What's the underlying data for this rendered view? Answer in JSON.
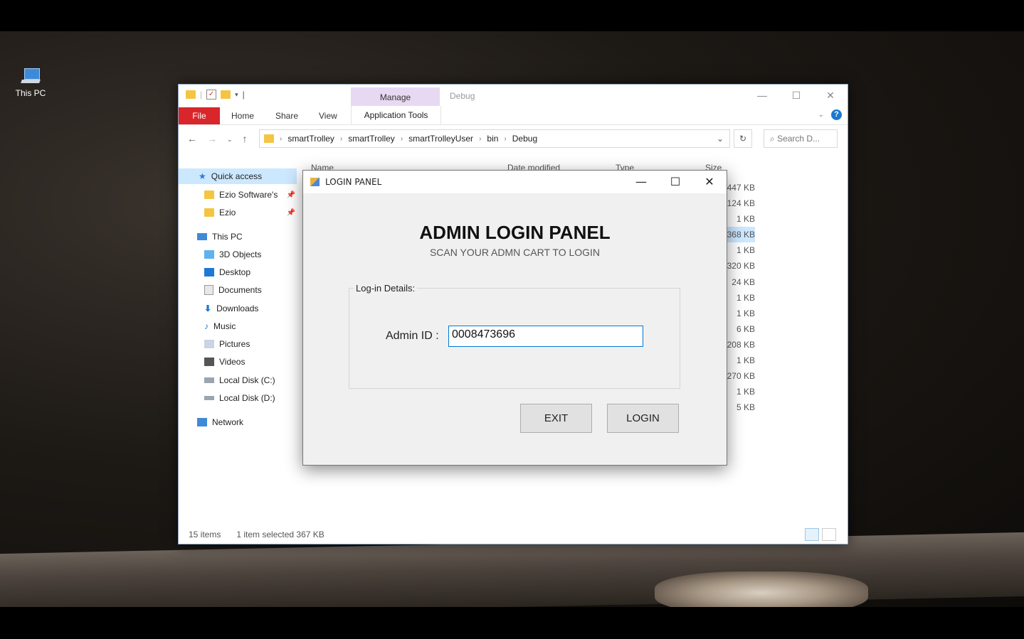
{
  "desktop": {
    "icon_label": "This PC"
  },
  "explorer": {
    "ribbon": {
      "manage": "Manage",
      "context_title": "Debug",
      "tabs": [
        "File",
        "Home",
        "Share",
        "View",
        "Application Tools"
      ]
    },
    "breadcrumb": [
      "smartTrolley",
      "smartTrolley",
      "smartTrolleyUser",
      "bin",
      "Debug"
    ],
    "search_placeholder": "Search D...",
    "sidebar": [
      {
        "label": "Quick access",
        "icon": "star-icon"
      },
      {
        "label": "Ezio Software's",
        "icon": "folder-icon"
      },
      {
        "label": "Ezio",
        "icon": "folder-icon"
      },
      {
        "label": "This PC",
        "icon": "computer-icon"
      },
      {
        "label": "3D Objects",
        "icon": "cube-icon"
      },
      {
        "label": "Desktop",
        "icon": "desktop-icon"
      },
      {
        "label": "Documents",
        "icon": "document-icon"
      },
      {
        "label": "Downloads",
        "icon": "download-icon"
      },
      {
        "label": "Music",
        "icon": "music-icon"
      },
      {
        "label": "Pictures",
        "icon": "picture-icon"
      },
      {
        "label": "Videos",
        "icon": "video-icon"
      },
      {
        "label": "Local Disk (C:)",
        "icon": "drive-icon"
      },
      {
        "label": "Local Disk (D:)",
        "icon": "drive-icon"
      },
      {
        "label": "Network",
        "icon": "network-icon"
      }
    ],
    "columns": [
      "Name",
      "Date modified",
      "Type",
      "Size"
    ],
    "sizes": [
      "447 KB",
      "124 KB",
      "1 KB",
      "368 KB",
      "1 KB",
      "320 KB",
      "24 KB",
      "1 KB",
      "1 KB",
      "6 KB",
      "208 KB",
      "1 KB",
      "270 KB",
      "1 KB",
      "5 KB"
    ],
    "status": {
      "items": "15 items",
      "selected": "1 item selected  367 KB"
    }
  },
  "dialog": {
    "title": "LOGIN PANEL",
    "heading": "ADMIN LOGIN PANEL",
    "subheading": "SCAN YOUR ADMN CART TO LOGIN",
    "group_label": "Log-in Details:",
    "admin_label": "Admin ID :",
    "admin_value": "0008473696",
    "exit_label": "EXIT",
    "login_label": "LOGIN"
  },
  "colors": {
    "file_tab": "#d9262b",
    "manage_tab": "#e8d9f3",
    "focus_border": "#0078d7",
    "selection": "#cce8ff"
  }
}
